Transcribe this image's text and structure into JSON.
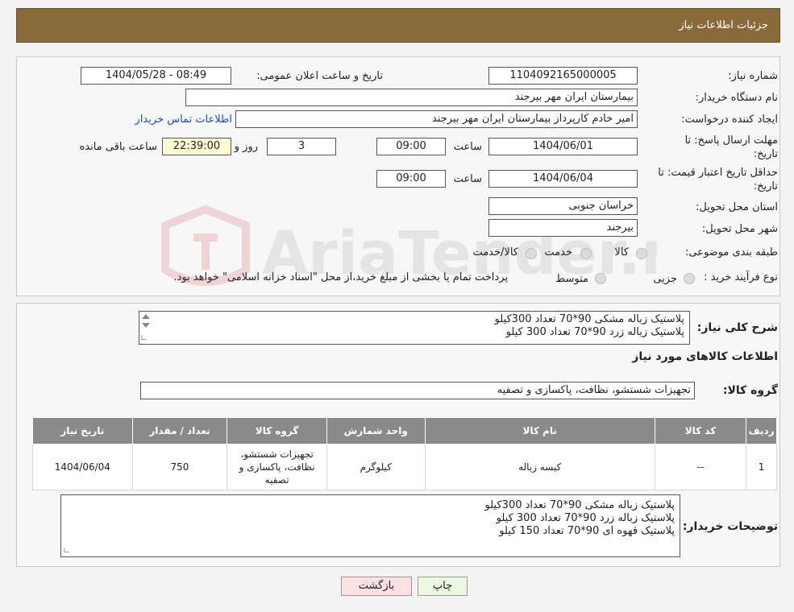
{
  "header": {
    "title": "جزئیات اطلاعات نیاز"
  },
  "watermark": {
    "text": "AriaTender.neT"
  },
  "form": {
    "need_number_label": "شماره نیاز:",
    "need_number": "1104092165000005",
    "announce_label": "تاریخ و ساعت اعلان عمومی:",
    "announce_value": "1404/05/28 - 08:49",
    "buyer_org_label": "نام دستگاه خریدار:",
    "buyer_org": "بیمارستان ایران مهر بیرجند",
    "creator_label": "ایجاد کننده درخواست:",
    "creator": "امیر خادم کارپرداز بیمارستان ایران مهر بیرجند",
    "contact_link": "اطلاعات تماس خریدار",
    "deadline_label_1": "مهلت ارسال پاسخ: تا",
    "deadline_label_2": "تاریخ:",
    "deadline_date": "1404/06/01",
    "time_label": "ساعت",
    "deadline_time": "09:00",
    "days_value": "3",
    "days_label": "روز و",
    "remaining_time": "22:39:00",
    "remaining_label": "ساعت باقی مانده",
    "validity_label_1": "حداقل تاریخ اعتبار قیمت: تا",
    "validity_label_2": "تاریخ:",
    "validity_date": "1404/06/04",
    "validity_time": "09:00",
    "province_label": "استان محل تحویل:",
    "province": "خراسان جنوبی",
    "city_label": "شهر محل تحویل:",
    "city": "بیرجند",
    "category_label": "طبقه بندی موضوعی:",
    "category_options": [
      "کالا",
      "خدمت",
      "کالا/خدمت"
    ],
    "process_label": "نوع فرآیند خرید :",
    "process_options": [
      "جزیی",
      "متوسط"
    ],
    "process_note": "پرداخت تمام یا بخشی از مبلغ خرید،از محل \"اسناد خزانه اسلامی\" خواهد بود."
  },
  "summary": {
    "label": "شرح کلی نیاز:",
    "lines": [
      "پلاستیک زباله مشکی 90*70 تعداد 300کیلو",
      "پلاستیک زباله زرد 90*70 تعداد 300 کیلو"
    ]
  },
  "goods": {
    "section_title": "اطلاعات کالاهای مورد نیاز",
    "group_label": "گروه کالا:",
    "group_value": "تجهیزات شستشو، نظافت، پاکسازی و تصفیه"
  },
  "table": {
    "headers": [
      "ردیف",
      "کد کالا",
      "نام کالا",
      "واحد شمارش",
      "گروه کالا",
      "تعداد / مقدار",
      "تاریخ نیاز"
    ],
    "rows": [
      {
        "row": "1",
        "code": "--",
        "name": "کیسه زباله",
        "unit": "کیلوگرم",
        "group": "تجهیزات شستشو، نظافت، پاکسازی و تصفیه",
        "qty": "750",
        "date": "1404/06/04"
      }
    ]
  },
  "buyer_notes": {
    "label": "توضیحات خریدار:",
    "lines": [
      "پلاستیک زباله مشکی 90*70 تعداد 300کیلو",
      "پلاستیک زباله زرد 90*70 تعداد 300 کیلو",
      "پلاستیک قهوه ای 90*70 تعداد 150 کیلو"
    ]
  },
  "buttons": {
    "print": "چاپ",
    "back": "بازگشت"
  },
  "colors": {
    "header_bg": "#8a6a3b",
    "link": "#1a4fb5",
    "back_button_bg": "#fde0e0",
    "print_button_bg": "#e9f7e3"
  }
}
